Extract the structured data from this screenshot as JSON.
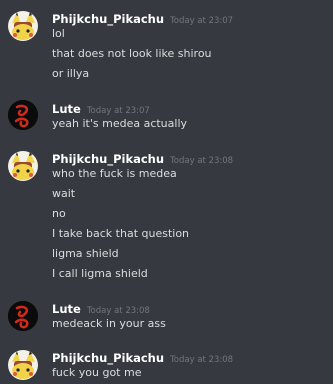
{
  "messages": [
    {
      "author": "Phijkchu_Pikachu",
      "timestamp": "Today at 23:07",
      "avatar_icon": "pikachu-avatar-icon",
      "lines": [
        "lol",
        "that does not look like shirou",
        "or illya"
      ]
    },
    {
      "author": "Lute",
      "timestamp": "Today at 23:07",
      "avatar_icon": "red-swirl-avatar-icon",
      "lines": [
        "yeah it's medea actually"
      ]
    },
    {
      "author": "Phijkchu_Pikachu",
      "timestamp": "Today at 23:08",
      "avatar_icon": "pikachu-avatar-icon",
      "lines": [
        "who the fuck is medea",
        "wait",
        "no",
        "I take back that question",
        "ligma shield",
        "I call ligma shield"
      ]
    },
    {
      "author": "Lute",
      "timestamp": "Today at 23:08",
      "avatar_icon": "red-swirl-avatar-icon",
      "lines": [
        "medeack in your ass"
      ]
    },
    {
      "author": "Phijkchu_Pikachu",
      "timestamp": "Today at 23:08",
      "avatar_icon": "pikachu-avatar-icon",
      "lines": [
        "fuck you got me"
      ]
    }
  ]
}
